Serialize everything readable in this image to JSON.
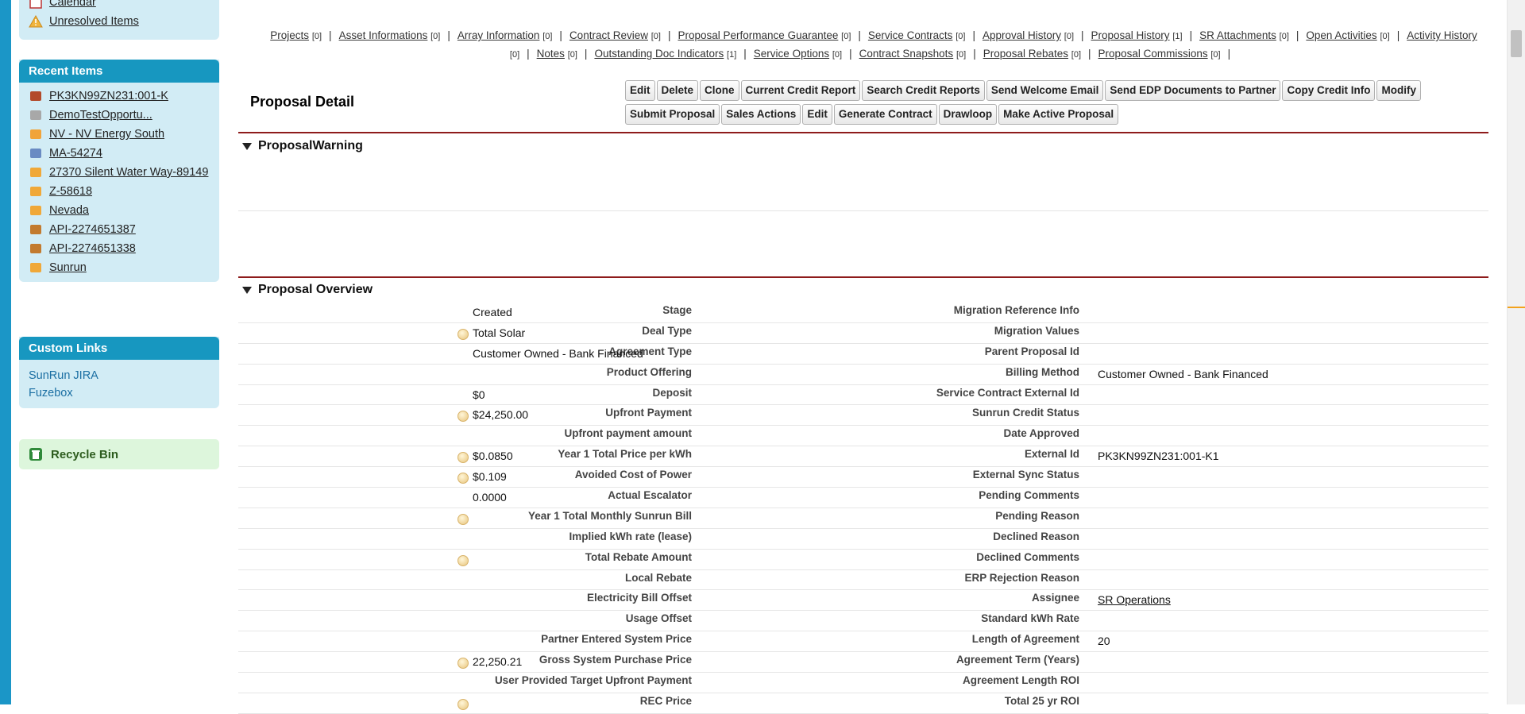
{
  "sidebar": {
    "top_items": [
      {
        "label": "Calendar",
        "icon": "calendar-icon"
      },
      {
        "label": "Unresolved Items",
        "icon": "warning-icon"
      }
    ],
    "recent_items_header": "Recent Items",
    "recent_items": [
      {
        "label": "PK3KN99ZN231:001-K",
        "icon": "proposal-icon",
        "color": "#b34a2a"
      },
      {
        "label": "DemoTestOpportu...",
        "icon": "opportunity-icon",
        "color": "#a8a8a8"
      },
      {
        "label": "NV - NV Energy South",
        "icon": "utility-icon",
        "color": "#f1a43a"
      },
      {
        "label": "MA-54274",
        "icon": "chart-icon",
        "color": "#6a8bc3"
      },
      {
        "label": "27370 Silent Water Way-89149",
        "icon": "box-icon",
        "color": "#f0a838"
      },
      {
        "label": "Z-58618",
        "icon": "pencil-icon",
        "color": "#f0a838"
      },
      {
        "label": "Nevada",
        "icon": "pencil-icon",
        "color": "#f0a838"
      },
      {
        "label": "API-2274651387",
        "icon": "cookie-icon",
        "color": "#c27a2e"
      },
      {
        "label": "API-2274651338",
        "icon": "cookie-icon",
        "color": "#c27a2e"
      },
      {
        "label": "Sunrun",
        "icon": "box-icon",
        "color": "#f0a838"
      }
    ],
    "custom_links_header": "Custom Links",
    "custom_links": [
      "SunRun JIRA",
      "Fuzebox"
    ],
    "recycle_bin": "Recycle Bin"
  },
  "related_links": [
    {
      "label": "Projects",
      "count": "[0]"
    },
    {
      "label": "Asset Informations",
      "count": "[0]"
    },
    {
      "label": "Array Information",
      "count": "[0]"
    },
    {
      "label": "Contract Review",
      "count": "[0]"
    },
    {
      "label": "Proposal Performance Guarantee",
      "count": "[0]"
    },
    {
      "label": "Service Contracts",
      "count": "[0]"
    },
    {
      "label": "Approval History",
      "count": "[0]"
    },
    {
      "label": "Proposal History",
      "count": "[1]"
    },
    {
      "label": "SR Attachments",
      "count": "[0]"
    },
    {
      "label": "Open Activities",
      "count": "[0]"
    },
    {
      "label": "Activity History",
      "count": "[0]"
    },
    {
      "label": "Notes",
      "count": "[0]"
    },
    {
      "label": "Outstanding Doc Indicators",
      "count": "[1]"
    },
    {
      "label": "Service Options",
      "count": "[0]"
    },
    {
      "label": "Contract Snapshots",
      "count": "[0]"
    },
    {
      "label": "Proposal Rebates",
      "count": "[0]"
    },
    {
      "label": "Proposal Commissions",
      "count": "[0]"
    }
  ],
  "detail": {
    "title": "Proposal Detail",
    "buttons_row1": [
      "Edit",
      "Delete",
      "Clone",
      "Current Credit Report",
      "Search Credit Reports",
      "Send Welcome Email",
      "Send EDP Documents to Partner",
      "Copy Credit Info",
      "Modify"
    ],
    "buttons_row2": [
      "Submit Proposal",
      "Sales Actions",
      "Edit",
      "Generate Contract",
      "Drawloop",
      "Make Active Proposal"
    ]
  },
  "sections": {
    "warning": "ProposalWarning",
    "overview": "Proposal Overview"
  },
  "fields": [
    {
      "l": "Stage",
      "lv": "Created",
      "lh": false,
      "r": "Migration Reference Info",
      "rv": "",
      "rh": false
    },
    {
      "l": "Deal Type",
      "lv": "Total Solar",
      "lh": true,
      "r": "Migration Values",
      "rv": "",
      "rh": false
    },
    {
      "l": "Agreement Type",
      "lv": "Customer Owned - Bank Financed",
      "lh": false,
      "r": "Parent Proposal Id",
      "rv": "",
      "rh": false
    },
    {
      "l": "Product Offering",
      "lv": "",
      "lh": false,
      "r": "Billing Method",
      "rv": "Customer Owned - Bank Financed",
      "rh": false
    },
    {
      "l": "Deposit",
      "lv": "$0",
      "lh": false,
      "r": "Service Contract External Id",
      "rv": "",
      "rh": false
    },
    {
      "l": "Upfront Payment",
      "lv": "$24,250.00",
      "lh": true,
      "r": "Sunrun Credit Status",
      "rv": "",
      "rh": false
    },
    {
      "l": "Upfront payment amount",
      "lv": "",
      "lh": false,
      "r": "Date Approved",
      "rv": "",
      "rh": false
    },
    {
      "l": "Year 1 Total Price per kWh",
      "lv": "$0.0850",
      "lh": true,
      "r": "External Id",
      "rv": "PK3KN99ZN231:001-K1",
      "rh": false
    },
    {
      "l": "Avoided Cost of Power",
      "lv": "$0.109",
      "lh": true,
      "r": "External Sync Status",
      "rv": "",
      "rh": false
    },
    {
      "l": "Actual Escalator",
      "lv": "0.0000",
      "lh": false,
      "r": "Pending Comments",
      "rv": "",
      "rh": false
    },
    {
      "l": "Year 1 Total Monthly Sunrun Bill",
      "lv": "",
      "lh": true,
      "r": "Pending Reason",
      "rv": "",
      "rh": false
    },
    {
      "l": "Implied kWh rate (lease)",
      "lv": "",
      "lh": false,
      "r": "Declined Reason",
      "rv": "",
      "rh": false
    },
    {
      "l": "Total Rebate Amount",
      "lv": "",
      "lh": true,
      "r": "Declined Comments",
      "rv": "",
      "rh": false
    },
    {
      "l": "Local Rebate",
      "lv": "",
      "lh": false,
      "r": "ERP Rejection Reason",
      "rv": "",
      "rh": false
    },
    {
      "l": "Electricity Bill Offset",
      "lv": "",
      "lh": false,
      "r": "Assignee",
      "rv": "SR Operations",
      "rh": false,
      "rlink": true
    },
    {
      "l": "Usage Offset",
      "lv": "",
      "lh": false,
      "r": "Standard kWh Rate",
      "rv": "",
      "rh": false
    },
    {
      "l": "Partner Entered System Price",
      "lv": "",
      "lh": false,
      "r": "Length of Agreement",
      "rv": "20",
      "rh": false
    },
    {
      "l": "Gross System Purchase Price",
      "lv": "22,250.21",
      "lh": true,
      "r": "Agreement Term (Years)",
      "rv": "",
      "rh": false
    },
    {
      "l": "User Provided Target Upfront Payment",
      "lv": "",
      "lh": false,
      "r": "Agreement Length ROI",
      "rv": "",
      "rh": false
    },
    {
      "l": "REC Price",
      "lv": "",
      "lh": true,
      "r": "Total 25 yr ROI",
      "rv": "",
      "rh": false
    }
  ],
  "colors": {
    "sidebar_header": "#1797c0",
    "sidebar_bg": "#d2ecf5",
    "section_rule": "#8e1b1b",
    "recycle_bg": "#ddf6dc"
  }
}
